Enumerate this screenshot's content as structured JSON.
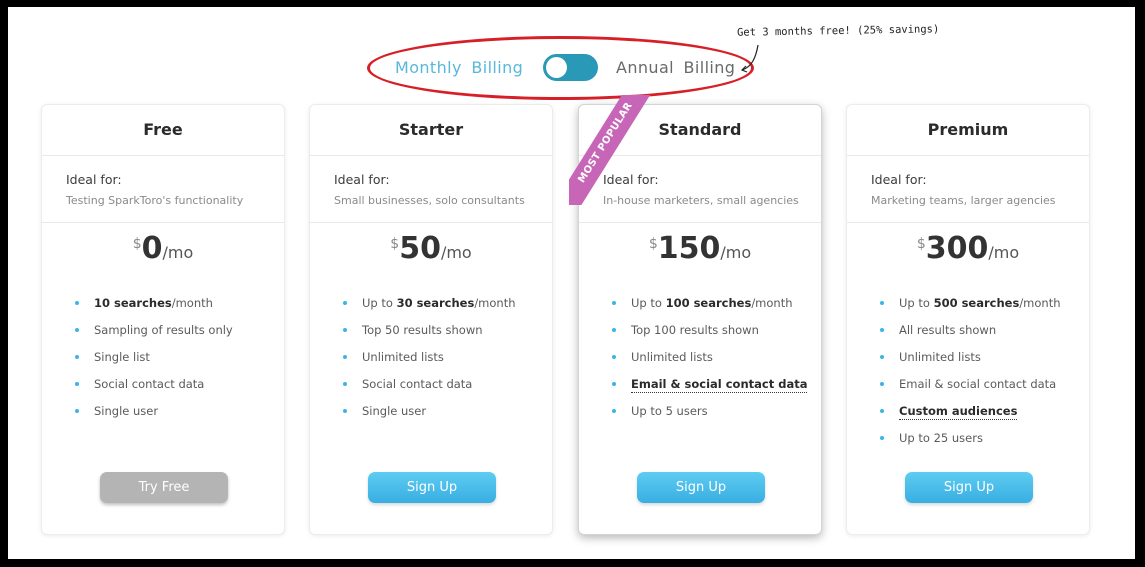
{
  "billing": {
    "monthly_label": "Monthly Billing",
    "annual_label": "Annual Billing",
    "annual_selected": false,
    "annotation": "Get 3 months free! (25% savings)"
  },
  "colors": {
    "accent": "#59b8d9",
    "toggle": "#2a98b7",
    "ribbon": "#c766b7",
    "highlight_oval": "#d71f27",
    "button_blue": "#3ab5e6",
    "button_gray": "#b4b4b4"
  },
  "plans": [
    {
      "name": "Free",
      "ideal_label": "Ideal for:",
      "ideal_text": "Testing SparkToro's functionality",
      "currency": "$",
      "price": "0",
      "unit": "/mo",
      "features": [
        {
          "pre": "",
          "bold": "10 searches",
          "post": "/month"
        },
        {
          "pre": "Sampling of results only",
          "bold": "",
          "post": ""
        },
        {
          "pre": "Single list",
          "bold": "",
          "post": ""
        },
        {
          "pre": "Social contact data",
          "bold": "",
          "post": ""
        },
        {
          "pre": "Single user",
          "bold": "",
          "post": ""
        }
      ],
      "cta": "Try Free"
    },
    {
      "name": "Starter",
      "ideal_label": "Ideal for:",
      "ideal_text": "Small businesses, solo consultants",
      "currency": "$",
      "price": "50",
      "unit": "/mo",
      "features": [
        {
          "pre": "Up to ",
          "bold": "30 searches",
          "post": "/month"
        },
        {
          "pre": "Top 50 results shown",
          "bold": "",
          "post": ""
        },
        {
          "pre": "Unlimited lists",
          "bold": "",
          "post": ""
        },
        {
          "pre": "Social contact data",
          "bold": "",
          "post": ""
        },
        {
          "pre": "Single user",
          "bold": "",
          "post": ""
        }
      ],
      "cta": "Sign Up"
    },
    {
      "name": "Standard",
      "badge": "MOST POPULAR",
      "ideal_label": "Ideal for:",
      "ideal_text": "In-house marketers, small agencies",
      "currency": "$",
      "price": "150",
      "unit": "/mo",
      "features": [
        {
          "pre": "Up to ",
          "bold": "100 searches",
          "post": "/month"
        },
        {
          "pre": "Top 100 results shown",
          "bold": "",
          "post": ""
        },
        {
          "pre": "Unlimited lists",
          "bold": "",
          "post": ""
        },
        {
          "underline": "Email & social contact data"
        },
        {
          "pre": "Up to 5 users",
          "bold": "",
          "post": ""
        }
      ],
      "cta": "Sign Up"
    },
    {
      "name": "Premium",
      "ideal_label": "Ideal for:",
      "ideal_text": "Marketing teams, larger agencies",
      "currency": "$",
      "price": "300",
      "unit": "/mo",
      "features": [
        {
          "pre": "Up to ",
          "bold": "500 searches",
          "post": "/month"
        },
        {
          "pre": "All results shown",
          "bold": "",
          "post": ""
        },
        {
          "pre": "Unlimited lists",
          "bold": "",
          "post": ""
        },
        {
          "pre": "Email & social contact data",
          "bold": "",
          "post": ""
        },
        {
          "underline": "Custom audiences"
        },
        {
          "pre": "Up to 25 users",
          "bold": "",
          "post": ""
        }
      ],
      "cta": "Sign Up"
    }
  ]
}
